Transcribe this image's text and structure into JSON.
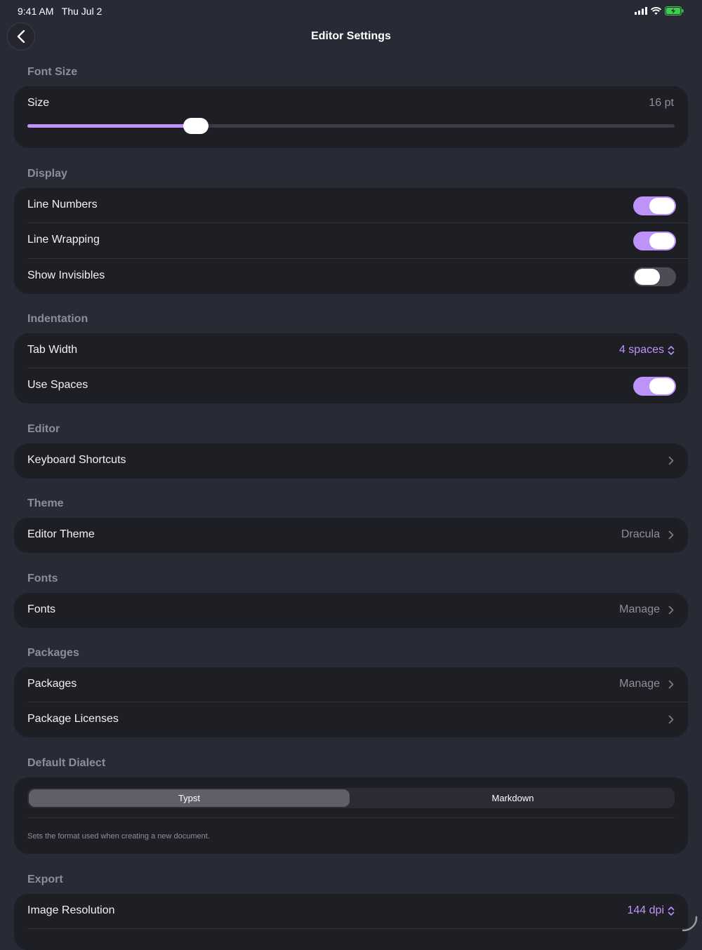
{
  "status_bar": {
    "time": "9:41 AM",
    "date": "Thu Jul 2",
    "battery_color": "#3ccf4e"
  },
  "nav": {
    "title": "Editor Settings",
    "back_icon": "chevron-left-icon"
  },
  "colors": {
    "accent": "#bd93f9",
    "background": "#282a36",
    "card": "#1e1f24"
  },
  "font_size": {
    "header": "Font Size",
    "size_label": "Size",
    "size_value": "16 pt",
    "slider_fraction": 0.26
  },
  "display": {
    "header": "Display",
    "line_numbers": {
      "label": "Line Numbers",
      "on": true
    },
    "line_wrapping": {
      "label": "Line Wrapping",
      "on": true
    },
    "show_invisibles": {
      "label": "Show Invisibles",
      "on": false
    }
  },
  "indentation": {
    "header": "Indentation",
    "tab_width": {
      "label": "Tab Width",
      "value": "4 spaces"
    },
    "use_spaces": {
      "label": "Use Spaces",
      "on": true
    }
  },
  "editor": {
    "header": "Editor",
    "keyboard_shortcuts": {
      "label": "Keyboard Shortcuts"
    }
  },
  "theme": {
    "header": "Theme",
    "editor_theme": {
      "label": "Editor Theme",
      "value": "Dracula"
    }
  },
  "fonts": {
    "header": "Fonts",
    "fonts_row": {
      "label": "Fonts",
      "value": "Manage"
    }
  },
  "packages": {
    "header": "Packages",
    "packages_row": {
      "label": "Packages",
      "value": "Manage"
    },
    "licenses_row": {
      "label": "Package Licenses"
    }
  },
  "default_dialect": {
    "header": "Default Dialect",
    "options": [
      "Typst",
      "Markdown"
    ],
    "selected": "Typst",
    "footnote": "Sets the format used when creating a new document."
  },
  "export": {
    "header": "Export",
    "image_resolution": {
      "label": "Image Resolution",
      "value": "144 dpi"
    }
  }
}
